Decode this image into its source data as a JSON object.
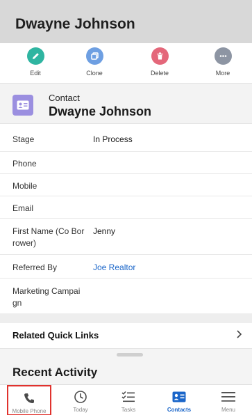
{
  "header": {
    "title": "Dwayne Johnson"
  },
  "actions": [
    {
      "label": "Edit",
      "icon": "pencil-icon",
      "color": "#2fb5a1"
    },
    {
      "label": "Clone",
      "icon": "clone-icon",
      "color": "#6e9fe2"
    },
    {
      "label": "Delete",
      "icon": "trash-icon",
      "color": "#e4677a"
    },
    {
      "label": "More",
      "icon": "more-icon",
      "color": "#8d95a3"
    }
  ],
  "contact": {
    "type": "Contact",
    "name": "Dwayne Johnson",
    "avatar_color": "#9b8fe0"
  },
  "fields": [
    {
      "label": "Stage",
      "value": "In Process"
    },
    {
      "label": "Phone",
      "value": ""
    },
    {
      "label": "Mobile",
      "value": ""
    },
    {
      "label": "Email",
      "value": ""
    },
    {
      "label": "First Name (Co Bor rower)",
      "value": "Jenny"
    },
    {
      "label": "Referred By",
      "value": "Joe Realtor"
    },
    {
      "label": "Marketing Campai gn",
      "value": ""
    }
  ],
  "quick_links": {
    "title": "Related Quick Links"
  },
  "recent_activity": {
    "title": "Recent Activity"
  },
  "tabs": [
    {
      "label": "Mobile Phone",
      "icon": "phone-icon"
    },
    {
      "label": "Today",
      "icon": "clock-icon"
    },
    {
      "label": "Tasks",
      "icon": "tasks-icon"
    },
    {
      "label": "Contacts",
      "icon": "contact-card-icon",
      "active": true
    },
    {
      "label": "Menu",
      "icon": "hamburger-icon"
    }
  ],
  "colors": {
    "accent": "#1b66c9",
    "highlight_box": "#e0322d"
  }
}
